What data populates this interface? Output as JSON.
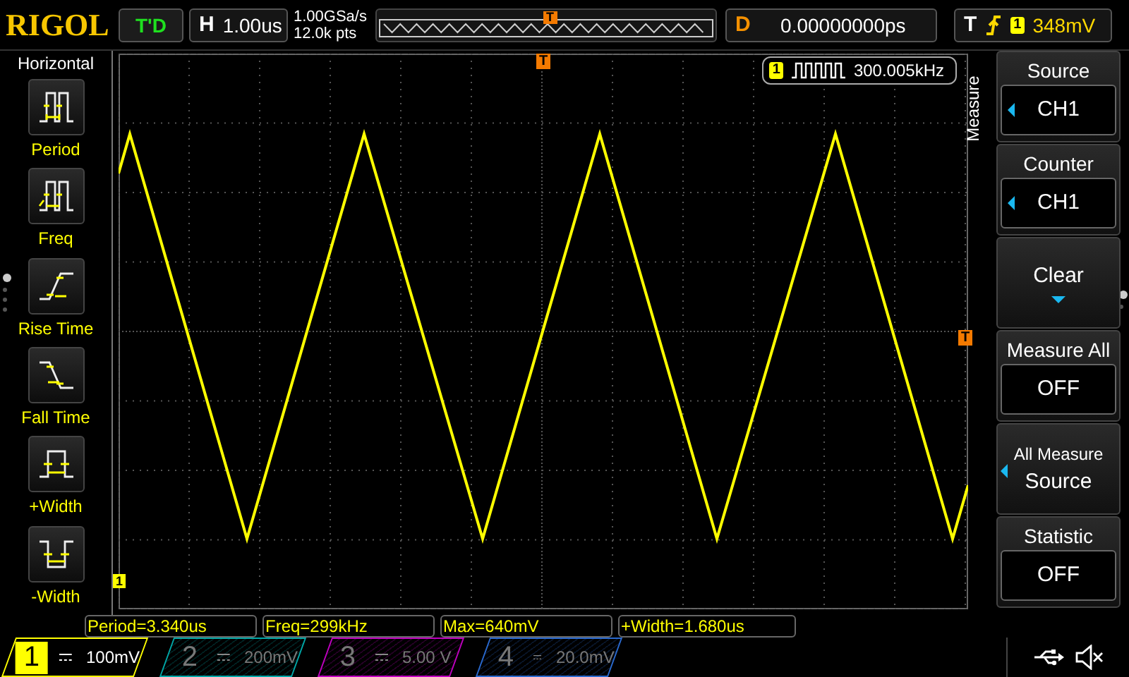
{
  "brand": "RIGOL",
  "run_status": "T'D",
  "horizontal": {
    "label": "H",
    "timebase": "1.00us",
    "sample_rate": "1.00GSa/s",
    "memory_depth": "12.0k pts",
    "trigger_mark": "T"
  },
  "delay": {
    "label": "D",
    "value": "0.00000000ps"
  },
  "trigger": {
    "label": "T",
    "source": "1",
    "level": "348mV"
  },
  "left_menu": {
    "title": "Horizontal",
    "items": [
      {
        "kind": "period",
        "label": "Period"
      },
      {
        "kind": "freq",
        "label": "Freq"
      },
      {
        "kind": "rise",
        "label": "Rise Time"
      },
      {
        "kind": "fall",
        "label": "Fall Time"
      },
      {
        "kind": "pwidth",
        "label": "+Width"
      },
      {
        "kind": "nwidth",
        "label": "-Width"
      }
    ],
    "pages": [
      {
        "selected": true
      },
      {
        "selected": false
      },
      {
        "selected": false
      },
      {
        "selected": false
      }
    ]
  },
  "screen": {
    "trigger_position_mark": "T",
    "trigger_level_mark": "T",
    "channel_marker": "1"
  },
  "counter": {
    "channel": "1",
    "frequency": "300.005kHz"
  },
  "measurements": [
    "Period=3.340us",
    "Freq=299kHz",
    "Max=640mV",
    "+Width=1.680us"
  ],
  "right_menu": {
    "title": "Measure",
    "items": [
      {
        "kind": "select",
        "label": "Source",
        "value": "CH1"
      },
      {
        "kind": "select",
        "label": "Counter",
        "value": "CH1"
      },
      {
        "kind": "action",
        "label": "Clear"
      },
      {
        "kind": "value",
        "label": "Measure All",
        "value": "OFF"
      },
      {
        "kind": "submenu",
        "label": "All Measure",
        "value": "Source"
      },
      {
        "kind": "value",
        "label": "Statistic",
        "value": "OFF"
      }
    ],
    "pages": [
      {
        "selected": true
      },
      {
        "selected": false
      }
    ]
  },
  "channels": [
    {
      "number": "1",
      "scale": "100mV",
      "on": true,
      "color": "#ffff00"
    },
    {
      "number": "2",
      "scale": "200mV",
      "on": false,
      "color": "#00a8a8"
    },
    {
      "number": "3",
      "scale": "5.00 V",
      "on": false,
      "color": "#c000c0"
    },
    {
      "number": "4",
      "scale": "20.0mV",
      "on": false,
      "color": "#2a6ad0"
    }
  ]
}
